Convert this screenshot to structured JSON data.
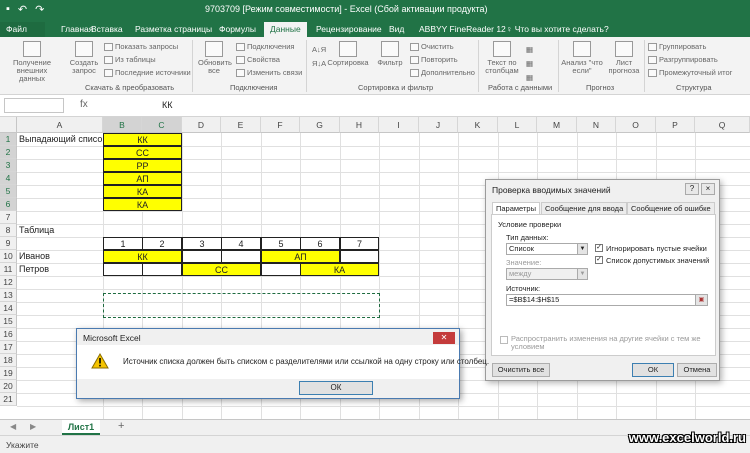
{
  "window": {
    "title": "9703709 [Режим совместимости] - Excel (Сбой активации продукта)"
  },
  "tabs": [
    "Файл",
    "Главная",
    "Вставка",
    "Разметка страницы",
    "Формулы",
    "Данные",
    "Рецензирование",
    "Вид",
    "ABBYY FineReader 12",
    "Что вы хотите сделать?"
  ],
  "ribbon": {
    "get_external": "Получение внешних данных",
    "new_query": "Создать запрос",
    "show_queries": "Показать запросы",
    "from_table": "Из таблицы",
    "recent_sources": "Последние источники",
    "refresh_all": "Обновить все",
    "connections": "Подключения",
    "properties": "Свойства",
    "edit_links": "Изменить связи",
    "sort": "Сортировка",
    "filter": "Фильтр",
    "clear": "Очистить",
    "reapply": "Повторить",
    "advanced": "Дополнительно",
    "text_to_columns": "Текст по столбцам",
    "what_if": "Анализ \"что если\"",
    "forecast_sheet": "Лист прогноза",
    "group": "Группировать",
    "ungroup": "Разгруппировать",
    "subtotal": "Промежуточный итог",
    "groups": {
      "get_transform": "Скачать & преобразовать",
      "connections": "Подключения",
      "sort_filter": "Сортировка и фильтр",
      "data_tools": "Работа с данными",
      "forecast": "Прогноз",
      "outline": "Структура"
    }
  },
  "formula_bar": {
    "name_box": "",
    "fx": "fx",
    "value": "КК"
  },
  "grid": {
    "columns": [
      "A",
      "B",
      "C",
      "D",
      "E",
      "F",
      "G",
      "H",
      "I",
      "J",
      "K",
      "L",
      "M",
      "N",
      "O",
      "P",
      "Q"
    ],
    "rows": [
      "1",
      "2",
      "3",
      "4",
      "5",
      "6",
      "7",
      "8",
      "9",
      "10",
      "11",
      "12",
      "13",
      "14",
      "15",
      "16",
      "17",
      "18",
      "19",
      "20",
      "21"
    ],
    "a1": "Выпадающий список:",
    "list": [
      "КК",
      "СС",
      "РР",
      "АП",
      "КА",
      "КА"
    ],
    "a8": "Таблица",
    "numbers": [
      "1",
      "2",
      "3",
      "4",
      "5",
      "6",
      "7"
    ],
    "a10": "Иванов",
    "a11": "Петров",
    "kk": "КК",
    "ap": "АП",
    "cc": "СС",
    "ka": "КА"
  },
  "sheet": {
    "tab": "Лист1",
    "add": "+"
  },
  "status": "Укажите",
  "watermark": "www.excelworld.ru",
  "dialog": {
    "title": "Проверка вводимых значений",
    "help": "?",
    "close": "×",
    "tab_params": "Параметры",
    "tab_input": "Сообщение для ввода",
    "tab_error": "Сообщение об ошибке",
    "condition": "Условие проверки",
    "type_label": "Тип данных:",
    "type_value": "Список",
    "value_label": "Значение:",
    "value_value": "между",
    "ignore_blank": "Игнорировать пустые ячейки",
    "in_cell": "Список допустимых значений",
    "source_label": "Источник:",
    "source_value": "=$B$14:$H$15",
    "spread": "Распространить изменения на другие ячейки с тем же условием",
    "clear_all": "Очистить все",
    "ok": "ОК",
    "cancel": "Отмена"
  },
  "msgbox": {
    "title": "Microsoft Excel",
    "text": "Источник списка должен быть списком с разделителями или ссылкой на одну строку или столбец.",
    "ok": "ОК"
  }
}
